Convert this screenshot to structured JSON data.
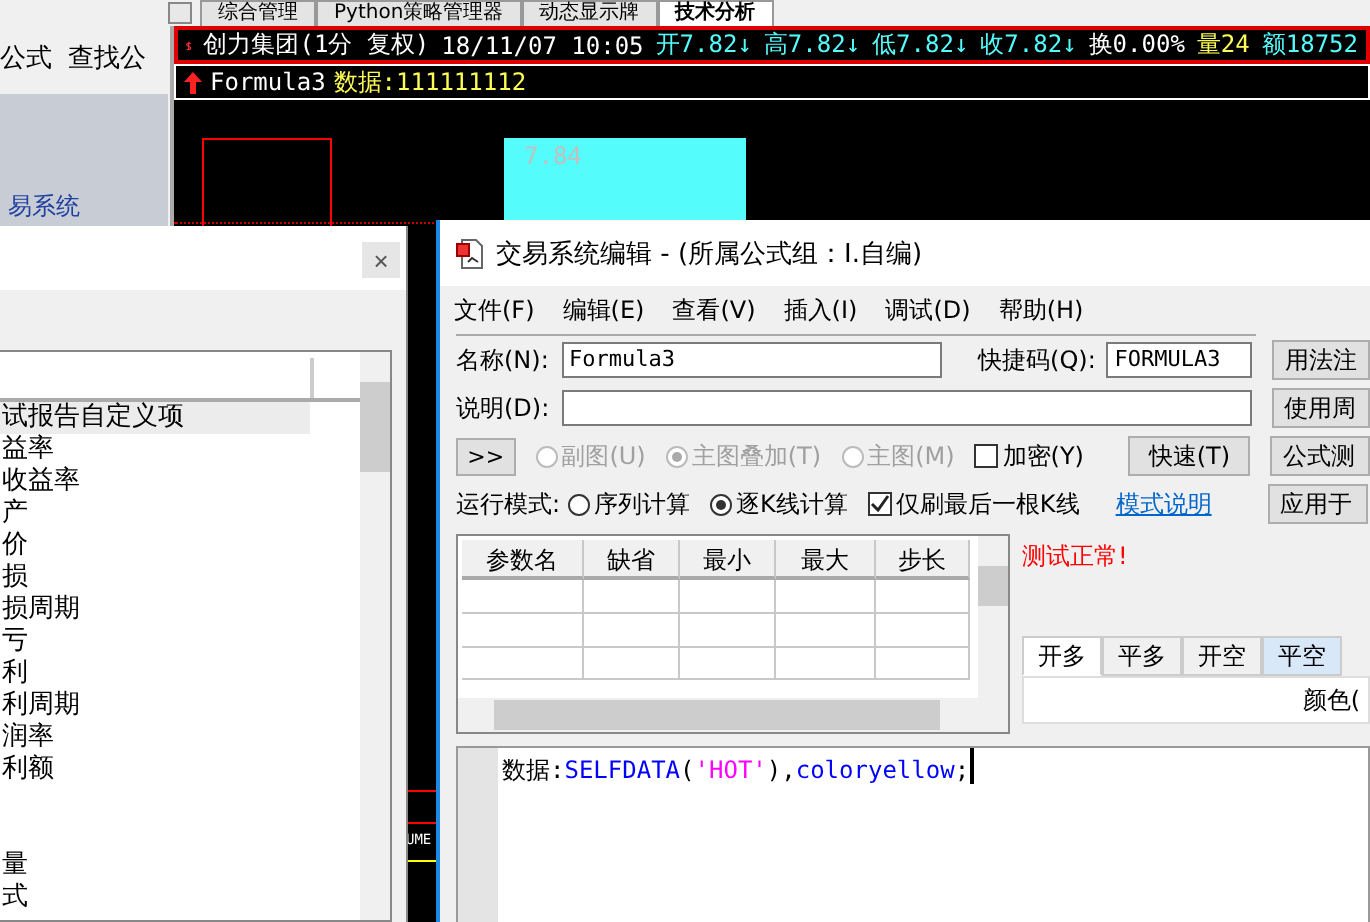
{
  "app_tabs": [
    {
      "label": "综合管理",
      "selected": false
    },
    {
      "label": "Python策略管理器",
      "selected": false
    },
    {
      "label": "动态显示牌",
      "selected": false
    },
    {
      "label": "技术分析",
      "selected": true
    }
  ],
  "toolbar": [
    "公式",
    "查找公"
  ],
  "side_label": "易系统",
  "chart": {
    "info": [
      {
        "text": "创力集团(1分 复权)",
        "kind": "plain"
      },
      {
        "text": "18/11/07 10:05",
        "kind": "plain"
      },
      {
        "text": "开7.82↓",
        "kind": "price"
      },
      {
        "text": "高7.82↓",
        "kind": "price"
      },
      {
        "text": "低7.82↓",
        "kind": "price"
      },
      {
        "text": "收7.82↓",
        "kind": "price"
      },
      {
        "text": "换0.00%",
        "kind": "plain"
      },
      {
        "text": "量24",
        "kind": "volume"
      },
      {
        "text": "额18752",
        "kind": "price"
      }
    ],
    "formula_name": "Formula3",
    "formula_value": "数据:111111112",
    "price_label": "7.84",
    "volume_label": "UME"
  },
  "list_dialog": {
    "close": "×",
    "items": [
      {
        "kind": "text",
        "label": "试报告自定义项",
        "selected": true
      },
      {
        "kind": "text",
        "label": "益率",
        "selected": false
      },
      {
        "kind": "text",
        "label": "收益率",
        "selected": false
      },
      {
        "kind": "text",
        "label": "产",
        "selected": false
      },
      {
        "kind": "text",
        "label": "价",
        "selected": false
      },
      {
        "kind": "text",
        "label": "损",
        "selected": false
      },
      {
        "kind": "text",
        "label": "损周期",
        "selected": false
      },
      {
        "kind": "text",
        "label": "亏",
        "selected": false
      },
      {
        "kind": "text",
        "label": "利",
        "selected": false
      },
      {
        "kind": "text",
        "label": "利周期",
        "selected": false
      },
      {
        "kind": "text",
        "label": "润率",
        "selected": false
      },
      {
        "kind": "text",
        "label": "利额",
        "selected": false
      },
      {
        "kind": "blank"
      },
      {
        "kind": "blank"
      },
      {
        "kind": "text",
        "label": "量",
        "selected": false
      },
      {
        "kind": "text",
        "label": "式",
        "selected": false
      }
    ]
  },
  "editor": {
    "title": "交易系统编辑 - (所属公式组：I.自编)",
    "menu": [
      "文件(F)",
      "编辑(E)",
      "查看(V)",
      "插入(I)",
      "调试(D)",
      "帮助(H)"
    ],
    "name_label": "名称(N):",
    "name_value": "Formula3",
    "shortcut_label": "快捷码(Q):",
    "shortcut_value": "FORMULA3",
    "desc_label": "说明(D):",
    "expand_button": ">>",
    "chart_modes": [
      {
        "label": "副图(U)",
        "selected": false,
        "disabled": true
      },
      {
        "label": "主图叠加(T)",
        "selected": true,
        "disabled": true
      },
      {
        "label": "主图(M)",
        "selected": false,
        "disabled": true
      }
    ],
    "encrypt": {
      "label": "加密(Y)",
      "checked": false
    },
    "quick_button": "快速(T)",
    "side_buttons": [
      "用法注",
      "使用周",
      "公式测",
      "应用于"
    ],
    "run_mode_label": "运行模式:",
    "run_modes": [
      {
        "label": "序列计算",
        "selected": false
      },
      {
        "label": "逐K线计算",
        "selected": true
      }
    ],
    "refresh_last": {
      "label": "仅刷最后一根K线",
      "checked": true
    },
    "mode_help_link": "模式说明",
    "param_columns": [
      "参数名",
      "缺省",
      "最小",
      "最大",
      "步长"
    ],
    "status": "测试正常!",
    "signal_tabs": [
      {
        "label": "开多",
        "selected": true
      },
      {
        "label": "平多",
        "selected": false
      },
      {
        "label": "开空",
        "selected": false
      },
      {
        "label": "平空",
        "selected": false
      }
    ],
    "color_label": "颜色(",
    "code": [
      {
        "kind": "plain",
        "text": "数据:"
      },
      {
        "kind": "function",
        "text": "SELFDATA"
      },
      {
        "kind": "plain",
        "text": "("
      },
      {
        "kind": "string",
        "text": "'HOT'"
      },
      {
        "kind": "plain",
        "text": "),"
      },
      {
        "kind": "function",
        "text": "coloryellow"
      },
      {
        "kind": "plain",
        "text": ";"
      }
    ]
  }
}
